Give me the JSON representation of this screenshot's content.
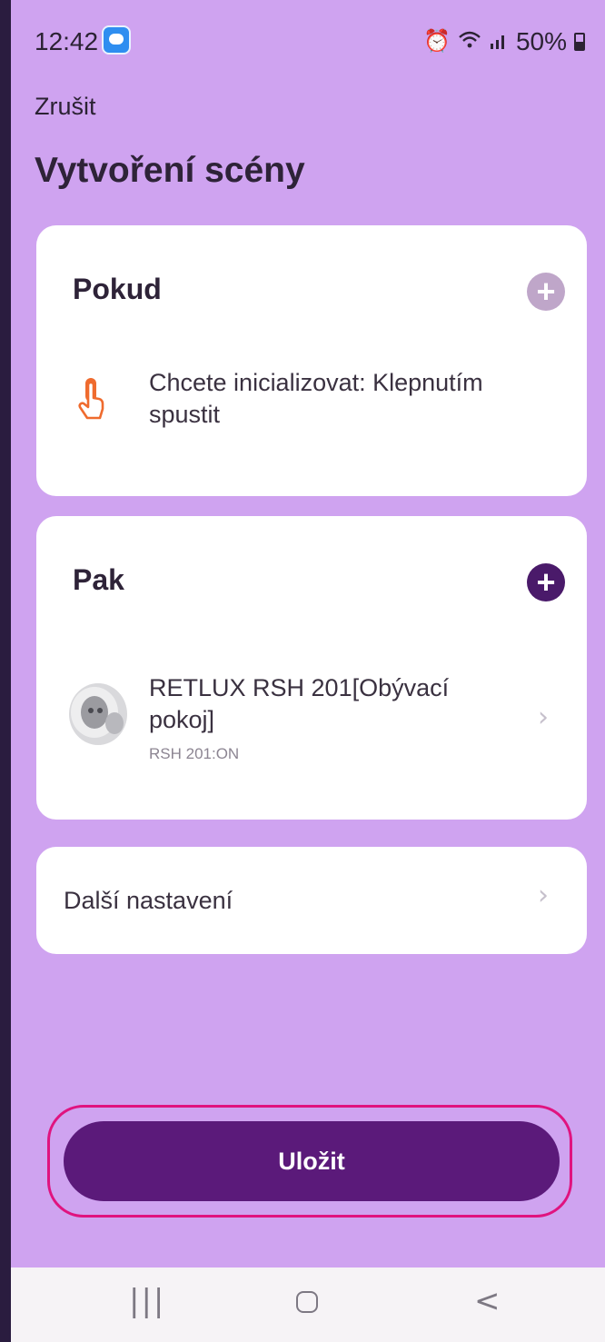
{
  "status_bar": {
    "time": "12:42",
    "battery": "50%"
  },
  "header": {
    "cancel_label": "Zrušit",
    "title": "Vytvoření scény"
  },
  "if_card": {
    "heading": "Pokud",
    "condition_text": "Chcete inicializovat: Klepnutím spustit"
  },
  "then_card": {
    "heading": "Pak",
    "action_title": "RETLUX RSH 201[Obývací pokoj]",
    "action_sub": "RSH 201:ON"
  },
  "more_settings": {
    "label": "Další nastavení"
  },
  "save_button": {
    "label": "Uložit"
  },
  "colors": {
    "background": "#cfa3f0",
    "primary": "#5b1a7a",
    "highlight_outline": "#e0137f",
    "tap_icon": "#ef6b2e"
  },
  "icons": {
    "tap": "hand-tap-icon",
    "device": "smart-plug-icon",
    "add": "plus-circle-icon",
    "chevron": "chevron-right-icon"
  }
}
